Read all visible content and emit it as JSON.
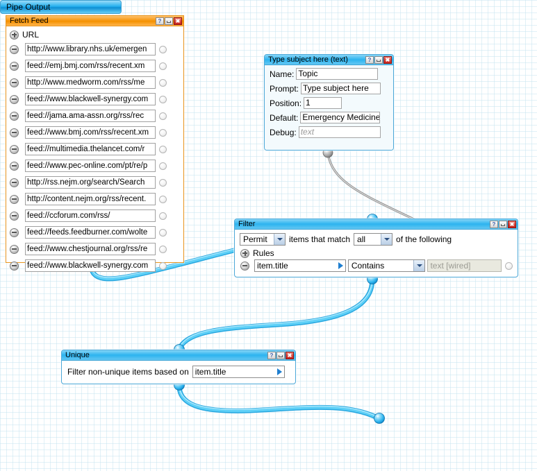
{
  "app": {
    "editor": "Yahoo Pipes Editor Canvas",
    "background_grid_color": "#c8e5f0"
  },
  "modules": {
    "fetch_feed": {
      "title": "Fetch Feed",
      "accent_color": "#f59100",
      "section_label": "URL",
      "add_icon": "plus-circle-icon",
      "remove_icon": "minus-circle-icon",
      "urls": [
        "http://www.library.nhs.uk/emergen",
        "feed://emj.bmj.com/rss/recent.xm",
        "http://www.medworm.com/rss/me",
        "feed://www.blackwell-synergy.com",
        "feed://jama.ama-assn.org/rss/rec",
        "feed://www.bmj.com/rss/recent.xm",
        "feed://multimedia.thelancet.com/r",
        "feed://www.pec-online.com/pt/re/p",
        "http://rss.nejm.org/search/Search",
        "http://content.nejm.org/rss/recent.",
        "feed://ccforum.com/rss/",
        "feed://feeds.feedburner.com/wolte",
        "feed://www.chestjournal.org/rss/re",
        "feed://www.blackwell-synergy.com"
      ]
    },
    "text_input": {
      "title": "Type subject here (text)",
      "accent_color": "#2db4ef",
      "fields": [
        {
          "label": "Name:",
          "value": "Topic",
          "placeholder": ""
        },
        {
          "label": "Prompt:",
          "value": "Type subject here",
          "placeholder": ""
        },
        {
          "label": "Position:",
          "value": "1",
          "placeholder": ""
        },
        {
          "label": "Default:",
          "value": "Emergency Medicine",
          "placeholder": ""
        },
        {
          "label": "Debug:",
          "value": "",
          "placeholder": "text"
        }
      ]
    },
    "filter": {
      "title": "Filter",
      "accent_color": "#2db4ef",
      "permit_value": "Permit",
      "mid_text": "items that match",
      "match_value": "all",
      "tail_text": "of the following",
      "rules_label": "Rules",
      "rule": {
        "field": "item.title",
        "operator": "Contains",
        "value_placeholder": "text [wired]"
      }
    },
    "unique": {
      "title": "Unique",
      "accent_color": "#2db4ef",
      "label": "Filter non-unique items based on",
      "field_value": "item.title"
    },
    "pipe_output": {
      "title": "Pipe Output",
      "accent_color": "#0e8fd4"
    }
  },
  "window_buttons": {
    "help": "?",
    "minimize": "–",
    "close": "✖"
  },
  "wires": [
    {
      "from": "fetch_feed.output",
      "to": "filter.input",
      "color": "#33bbf0"
    },
    {
      "from": "text_input.output",
      "to": "filter.rule_value",
      "color": "#9a9a9a"
    },
    {
      "from": "filter.output",
      "to": "unique.input",
      "color": "#33bbf0"
    },
    {
      "from": "unique.output",
      "to": "pipe_output.input",
      "color": "#33bbf0"
    }
  ]
}
